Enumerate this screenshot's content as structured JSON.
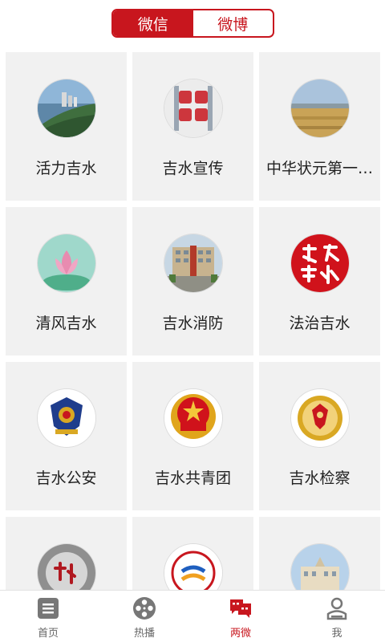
{
  "tabs": {
    "wechat_label": "微信",
    "weibo_label": "微博",
    "active": "wechat"
  },
  "accounts": [
    {
      "name": "活力吉水",
      "icon": "riverside-city-photo"
    },
    {
      "name": "吉水宣传",
      "icon": "jishui-xuanchuan-calligraphy-logo"
    },
    {
      "name": "中华状元第一…",
      "icon": "field-landscape-photo"
    },
    {
      "name": "清风吉水",
      "icon": "lotus-flower-logo"
    },
    {
      "name": "吉水消防",
      "icon": "fire-station-building-photo"
    },
    {
      "name": "法治吉水",
      "icon": "fazhi-jishui-red-logo"
    },
    {
      "name": "吉水公安",
      "icon": "police-emblem"
    },
    {
      "name": "吉水共青团",
      "icon": "youth-league-emblem"
    },
    {
      "name": "吉水检察",
      "icon": "procuratorate-emblem"
    },
    {
      "name": "",
      "icon": "jishui-calligraphy-logo"
    },
    {
      "name": "",
      "icon": "sports-logo"
    },
    {
      "name": "",
      "icon": "government-building-photo"
    }
  ],
  "nav": {
    "items": [
      {
        "label": "首页",
        "icon": "home-doc-icon"
      },
      {
        "label": "热播",
        "icon": "film-reel-icon"
      },
      {
        "label": "两微",
        "icon": "chat-bubbles-icon"
      },
      {
        "label": "我",
        "icon": "person-icon"
      }
    ],
    "active_index": 2
  },
  "colors": {
    "accent": "#c8161e",
    "card_bg": "#f1f1f1",
    "inactive": "#777777"
  }
}
